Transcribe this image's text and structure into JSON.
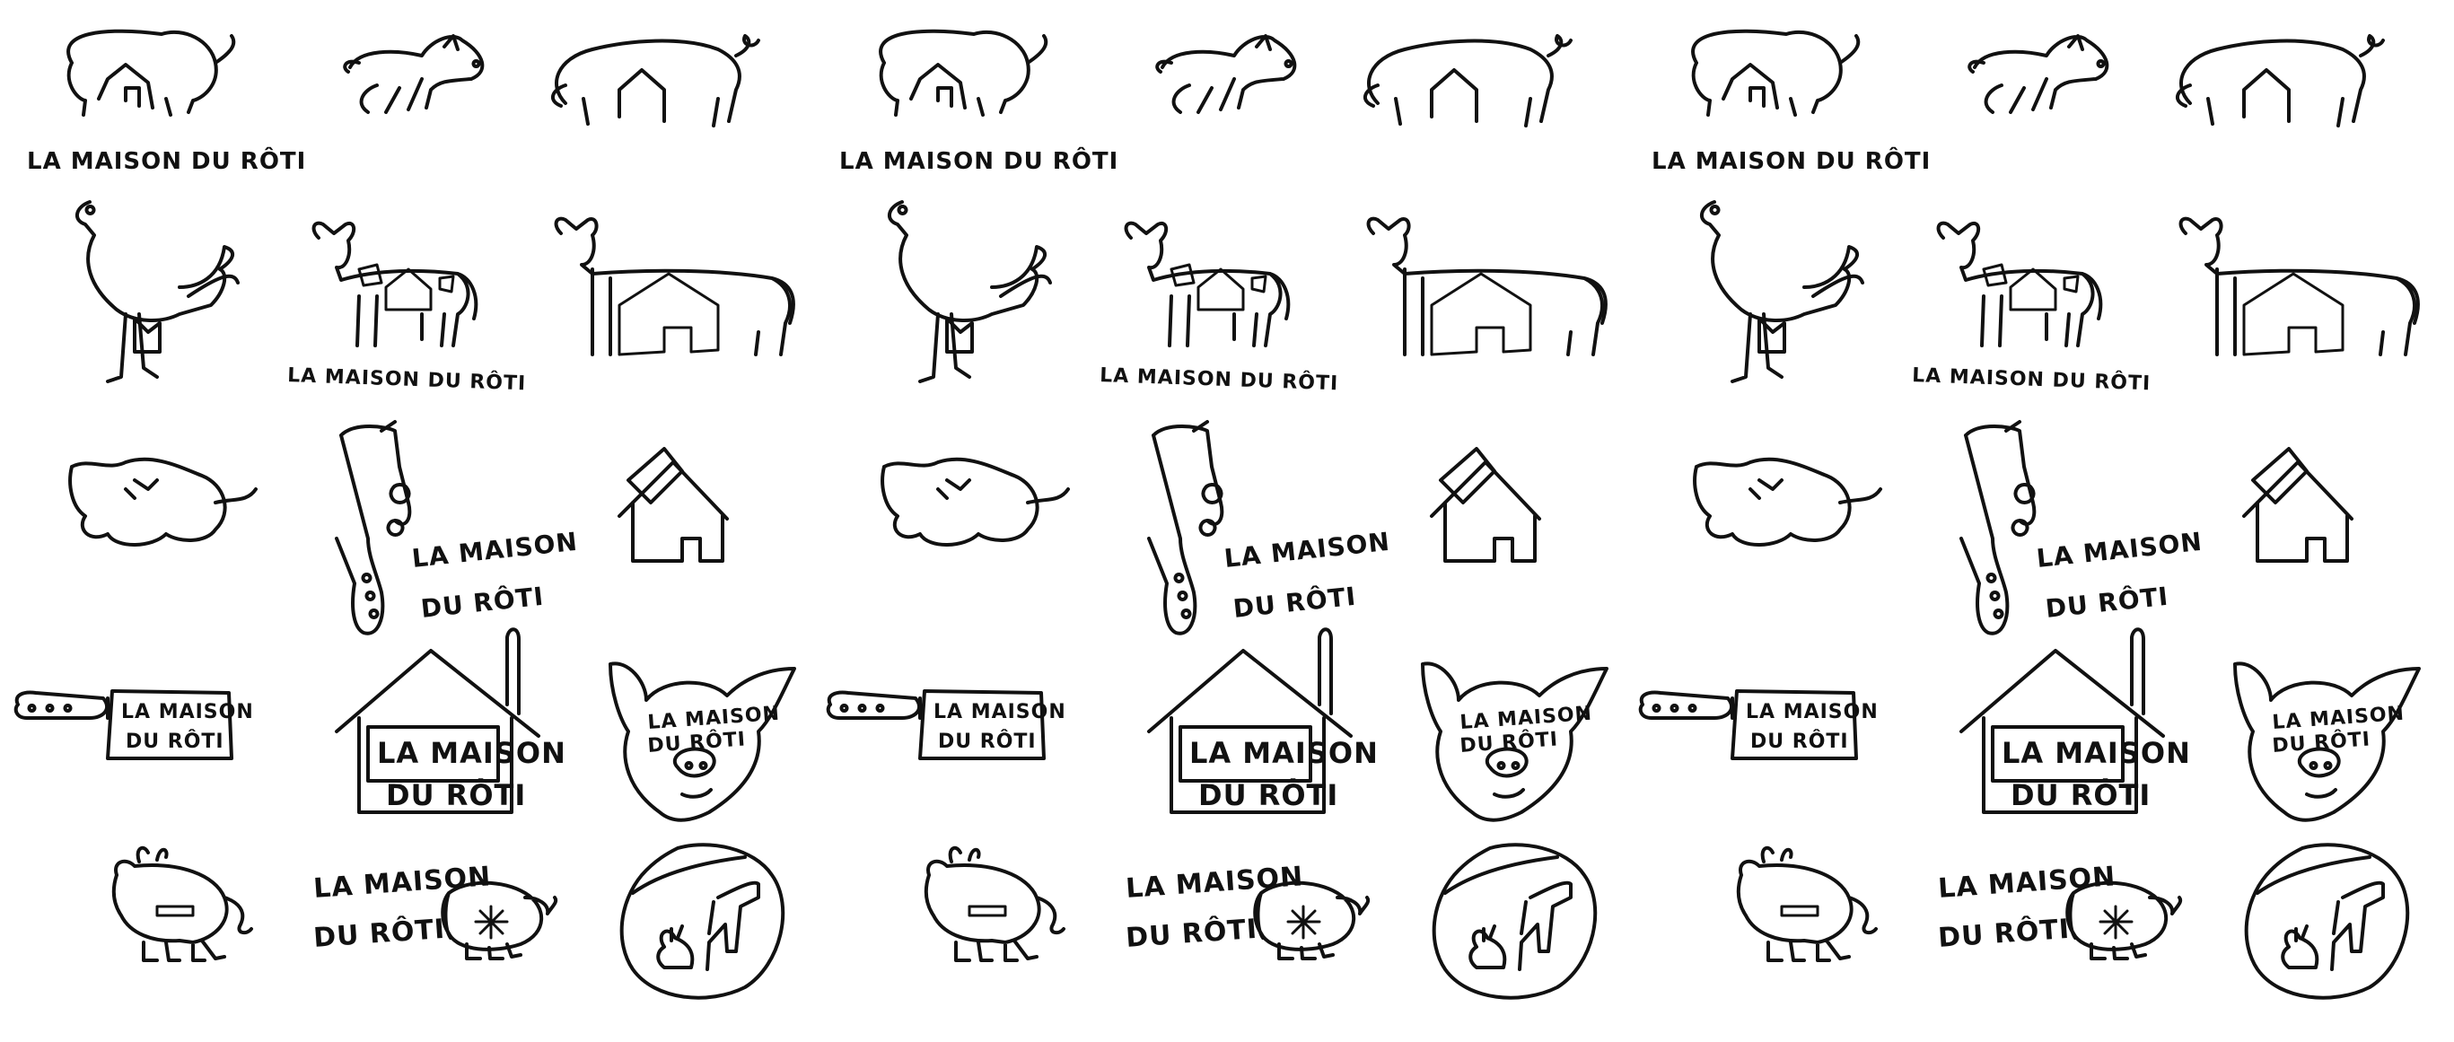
{
  "sheet": {
    "brand_text": "LA MAISON DU RÔTI",
    "brand_line1": "LA MAISON",
    "brand_line2": "DU RÔTI",
    "knife_line1": "LA MAISON",
    "knife_line2": "DU RÔTI",
    "pig_face_line1": "LA MAISON",
    "pig_face_line2": "DU RÔTI",
    "ink_color": "#111111",
    "background_color": "#ffffff"
  },
  "sketch_groups": [
    {
      "group": 1
    },
    {
      "group": 2
    },
    {
      "group": 3
    }
  ],
  "sketches": [
    {
      "name": "pig-house-logo-sketch",
      "icon": "pig-icon",
      "caption": "LA MAISON DU RÔTI"
    },
    {
      "name": "pig-side-sketch",
      "icon": "pig-icon"
    },
    {
      "name": "pig-walking-sketch",
      "icon": "pig-icon"
    },
    {
      "name": "rooster-sketch",
      "icon": "rooster-icon"
    },
    {
      "name": "cow-house-logo-sketch",
      "icon": "cow-icon",
      "caption": "LA MAISON DU RÔTI"
    },
    {
      "name": "cow-black-house-sketch",
      "icon": "cow-icon"
    },
    {
      "name": "squiggle-pig-sketch",
      "icon": "pig-icon"
    },
    {
      "name": "cleaver-logo-sketch",
      "icon": "cleaver-icon",
      "caption": "LA MAISON DU RÔTI"
    },
    {
      "name": "cleaver-house-sketch",
      "icon": "house-icon"
    },
    {
      "name": "knife-sign-sketch",
      "icon": "knife-icon",
      "caption": "LA MAISON DU RÔTI"
    },
    {
      "name": "house-sign-sketch",
      "icon": "house-icon",
      "caption": "LA MAISON DU RÔTI"
    },
    {
      "name": "pig-face-sketch",
      "icon": "pig-face-icon",
      "caption": "LA MAISON DU RÔTI"
    },
    {
      "name": "bull-roast-sketch",
      "icon": "bull-icon"
    },
    {
      "name": "ham-pig-logo-sketch",
      "icon": "ham-icon",
      "caption": "LA MAISON DU RÔTI"
    },
    {
      "name": "roundel-animals-sketch",
      "icon": "rabbit-icon"
    }
  ]
}
